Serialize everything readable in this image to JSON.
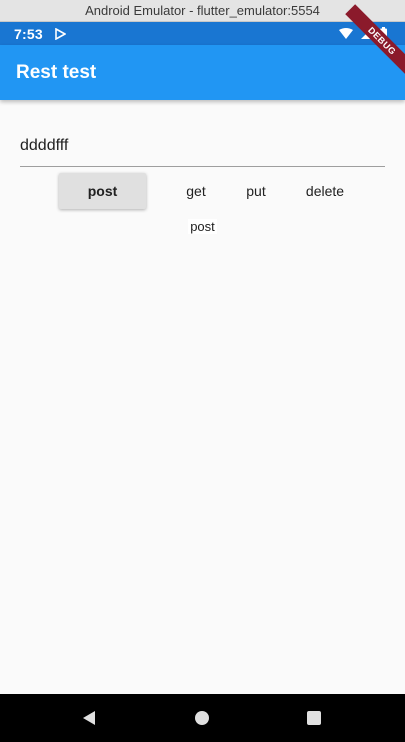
{
  "window": {
    "title": "Android Emulator - flutter_emulator:5554"
  },
  "status_bar": {
    "time": "7:53",
    "icons": [
      "play-store-icon",
      "wifi-icon",
      "signal-icon",
      "battery-icon"
    ]
  },
  "app_bar": {
    "title": "Rest test"
  },
  "debug_banner": "DEBUG",
  "text_field": {
    "value": "ddddfff"
  },
  "buttons": {
    "post": "post",
    "get": "get",
    "put": "put",
    "delete": "delete"
  },
  "result": "post",
  "nav_bar": {
    "icons": [
      "back-icon",
      "home-icon",
      "recents-icon"
    ]
  },
  "colors": {
    "status_bar": "#1976d2",
    "app_bar": "#2196f3",
    "background": "#fafafa",
    "raised_button": "#e0e0e0",
    "debug_banner": "#8b1a2b"
  }
}
